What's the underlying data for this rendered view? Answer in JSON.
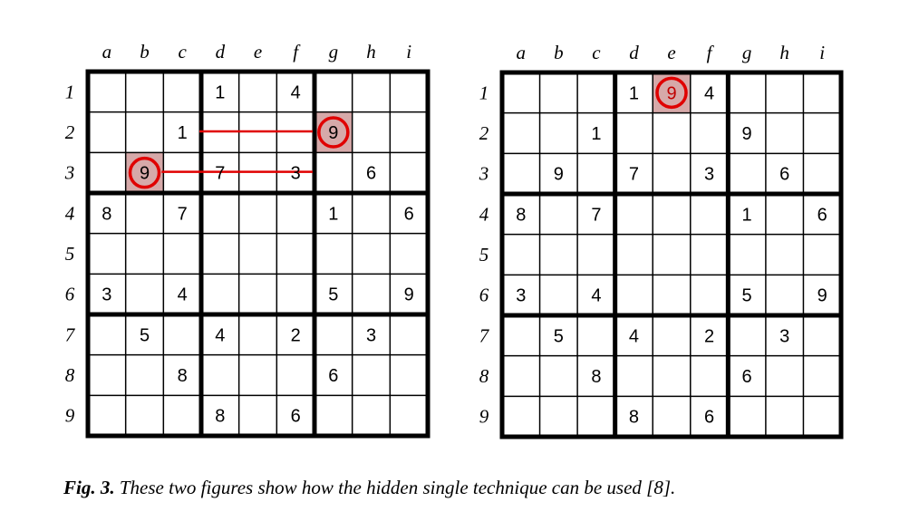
{
  "columns": [
    "a",
    "b",
    "c",
    "d",
    "e",
    "f",
    "g",
    "h",
    "i"
  ],
  "rows": [
    "1",
    "2",
    "3",
    "4",
    "5",
    "6",
    "7",
    "8",
    "9"
  ],
  "left_grid": {
    "cells": [
      [
        "",
        "",
        "",
        "1",
        "",
        "4",
        "",
        "",
        ""
      ],
      [
        "",
        "",
        "1",
        "",
        "",
        "",
        "9",
        "",
        ""
      ],
      [
        "",
        "9",
        "",
        "7",
        "",
        "3",
        "",
        "6",
        ""
      ],
      [
        "8",
        "",
        "7",
        "",
        "",
        "",
        "1",
        "",
        "6"
      ],
      [
        "",
        "",
        "",
        "",
        "",
        "",
        "",
        "",
        ""
      ],
      [
        "3",
        "",
        "4",
        "",
        "",
        "",
        "5",
        "",
        "9"
      ],
      [
        "",
        "5",
        "",
        "4",
        "",
        "2",
        "",
        "3",
        ""
      ],
      [
        "",
        "",
        "8",
        "",
        "",
        "",
        "6",
        "",
        ""
      ],
      [
        "",
        "",
        "",
        "8",
        "",
        "6",
        "",
        "",
        ""
      ]
    ],
    "highlighted": [
      [
        1,
        6
      ],
      [
        2,
        1
      ]
    ],
    "lines": [
      {
        "row": 1,
        "from_col": 2,
        "to_col": 6
      },
      {
        "row": 2,
        "from_col": 1,
        "to_col": 5
      }
    ]
  },
  "right_grid": {
    "cells": [
      [
        "",
        "",
        "",
        "1",
        "9",
        "4",
        "",
        "",
        ""
      ],
      [
        "",
        "",
        "1",
        "",
        "",
        "",
        "9",
        "",
        ""
      ],
      [
        "",
        "9",
        "",
        "7",
        "",
        "3",
        "",
        "6",
        ""
      ],
      [
        "8",
        "",
        "7",
        "",
        "",
        "",
        "1",
        "",
        "6"
      ],
      [
        "",
        "",
        "",
        "",
        "",
        "",
        "",
        "",
        ""
      ],
      [
        "3",
        "",
        "4",
        "",
        "",
        "",
        "5",
        "",
        "9"
      ],
      [
        "",
        "5",
        "",
        "4",
        "",
        "2",
        "",
        "3",
        ""
      ],
      [
        "",
        "",
        "8",
        "",
        "",
        "",
        "6",
        "",
        ""
      ],
      [
        "",
        "",
        "",
        "8",
        "",
        "6",
        "",
        "",
        ""
      ]
    ],
    "highlighted": [
      [
        0,
        4
      ]
    ],
    "lines": []
  },
  "colors": {
    "highlight_fill": "#d6a9a9",
    "highlight_stroke": "#e00000",
    "line": "#e00000",
    "grid": "#000000"
  },
  "caption": {
    "label": "Fig. 3.",
    "text": " These two figures show how the hidden single technique can be used [8]."
  }
}
